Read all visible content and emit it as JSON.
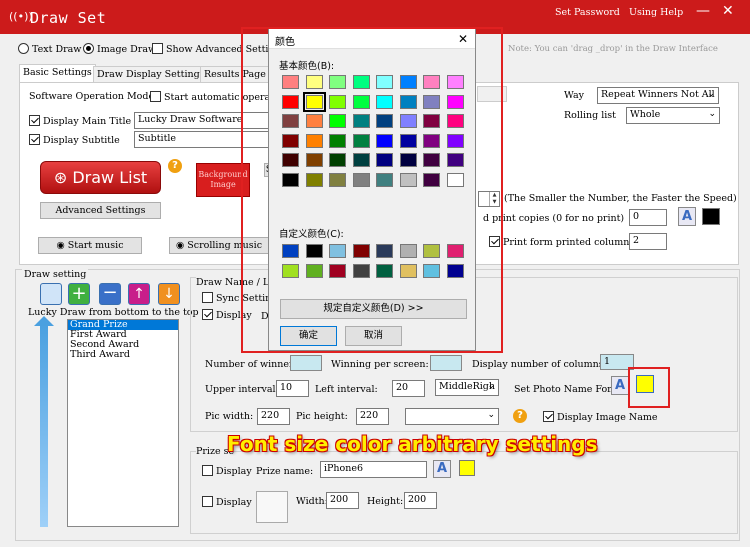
{
  "app": {
    "title": "Draw Set",
    "set_password": "Set Password",
    "using_help": "Using Help",
    "minimize": "—",
    "close": "✕"
  },
  "mode": {
    "text_draw": "Text Draw",
    "image_draw": "Image Draw",
    "show_advanced": "Show Advanced Settings",
    "note": "Note: You can 'drag _drop' in the Draw Interface"
  },
  "tabs": [
    "Basic Settings",
    "Draw Display Settings",
    "Results Page S"
  ],
  "basic": {
    "software_mode": "Software Operation Mode",
    "start_auto": "Start automatic operati",
    "display_main_title": "Display Main Title",
    "main_title_value": "Lucky Draw Software",
    "display_subtitle": "Display Subtitle",
    "subtitle_value": "Subtitle",
    "draw_list": "Draw List",
    "bg_image": "Background Image",
    "advanced_settings": "Advanced Settings",
    "start_music": "Start music",
    "scrolling_music": "Scrolling music",
    "s_btn": "S"
  },
  "right": {
    "way_label": "Way",
    "way_value": "Repeat Winners Not All",
    "rolling_label": "Rolling list",
    "rolling_value": "Whole",
    "speed_note": "(The Smaller the Number, the Faster the Speed)",
    "print_copies": "d print copies (0 for no print)",
    "print_copies_value": "0",
    "print_form": "Print form printed columns",
    "print_cols_value": "2"
  },
  "draw_setting": {
    "title": "Draw setting",
    "lucky_draw_dir": "Lucky Draw from bottom to the top",
    "prizes": [
      "Grand Prize",
      "First Award",
      "Second Award",
      "Third Award"
    ]
  },
  "name_list": {
    "title": "Draw Name / List",
    "sync": "Sync Setting",
    "display": "Display",
    "dr": "Dr",
    "num_winners": "Number of winners:",
    "winning_per_screen": "Winning per screen:",
    "display_cols": "Display number of columns:",
    "display_cols_value": "1",
    "upper_interval": "Upper interval:",
    "upper_value": "10",
    "left_interval": "Left interval:",
    "left_value": "20",
    "align_value": "MiddleRigh",
    "set_photo_font": "Set Photo Name Font",
    "pic_width": "Pic width:",
    "pic_width_value": "220",
    "pic_height": "Pic height:",
    "pic_height_value": "220",
    "display_image_name": "Display Image Name"
  },
  "prize": {
    "title": "Prize se",
    "display": "Display",
    "prize_name": "Prize name:",
    "prize_name_value": "iPhone6",
    "display2": "Display",
    "width_label": "Width:",
    "width_value": "200",
    "height_label": "Height:",
    "height_value": "200"
  },
  "dialog": {
    "title": "颜色",
    "basic_colors": "基本颜色(B):",
    "custom_colors": "自定义颜色(C):",
    "define_custom": "规定自定义颜色(D) >>",
    "ok": "确定",
    "cancel": "取消",
    "basic_palette": [
      [
        "#ff8080",
        "#ffff80",
        "#80ff80",
        "#00ff80",
        "#80ffff",
        "#0080ff",
        "#ff80c0",
        "#ff80ff"
      ],
      [
        "#ff0000",
        "#ffff00",
        "#80ff00",
        "#00ff40",
        "#00ffff",
        "#0080c0",
        "#8080c0",
        "#ff00ff"
      ],
      [
        "#804040",
        "#ff8040",
        "#00ff00",
        "#008080",
        "#004080",
        "#8080ff",
        "#800040",
        "#ff0080"
      ],
      [
        "#800000",
        "#ff8000",
        "#008000",
        "#008040",
        "#0000ff",
        "#0000a0",
        "#800080",
        "#8000ff"
      ],
      [
        "#400000",
        "#804000",
        "#004000",
        "#004040",
        "#000080",
        "#000040",
        "#400040",
        "#400080"
      ],
      [
        "#000000",
        "#808000",
        "#808040",
        "#808080",
        "#408080",
        "#c0c0c0",
        "#400040",
        "#ffffff"
      ]
    ],
    "custom_palette": [
      [
        "#0040c0",
        "#000000",
        "#80c0e0",
        "#800000",
        "#2a3a5a",
        "#b0b0b0",
        "#b0c040",
        "#e02070"
      ],
      [
        "#a0e020",
        "#60b020",
        "#a00020",
        "#404040",
        "#006040",
        "#e0c060",
        "#60c0e0",
        "#000090"
      ]
    ]
  },
  "caption": "Font size color arbitrary settings",
  "colors": {
    "brand": "#cc1b1b",
    "selected_font_color": "#ffff00"
  }
}
